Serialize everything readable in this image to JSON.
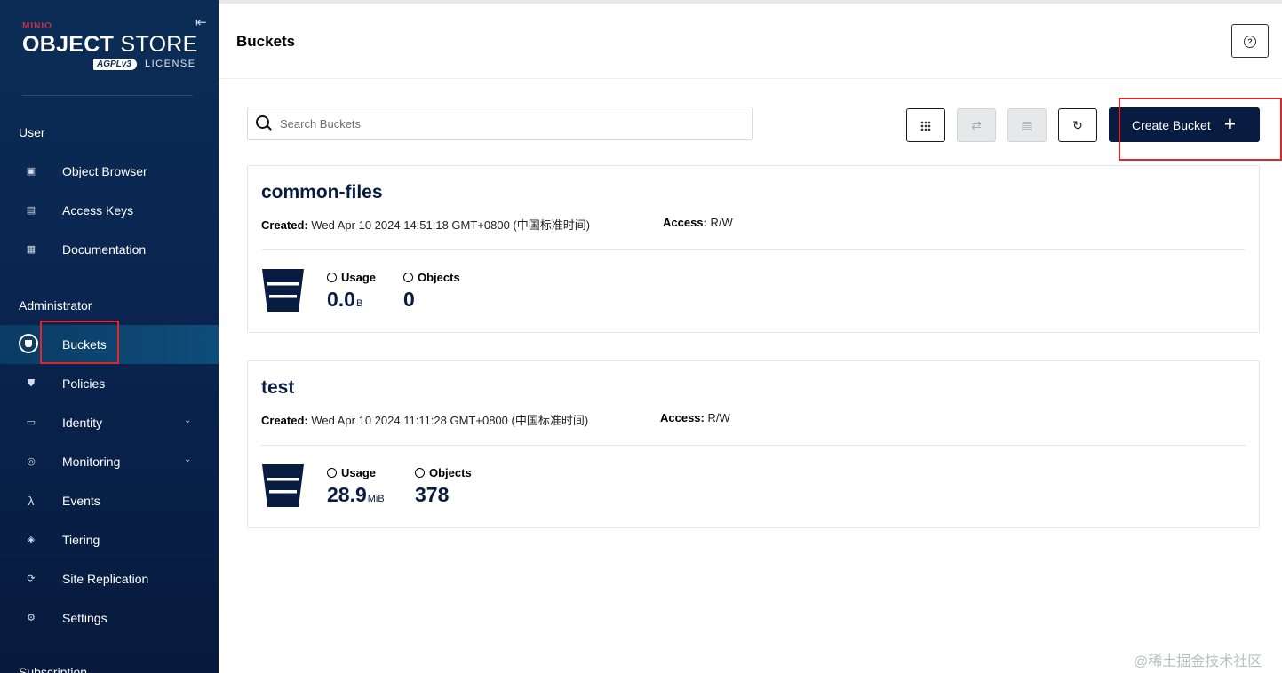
{
  "sidebar": {
    "logo": {
      "brand": "MINIO",
      "object": "OBJECT",
      "store": "STORE",
      "badge": "AGPLv3",
      "license": "LICENSE"
    },
    "sections": {
      "user": "User",
      "administrator": "Administrator",
      "subscription": "Subscription"
    },
    "user_items": [
      {
        "label": "Object Browser",
        "icon": "object-browser-icon"
      },
      {
        "label": "Access Keys",
        "icon": "access-keys-icon"
      },
      {
        "label": "Documentation",
        "icon": "documentation-icon"
      }
    ],
    "admin_items": [
      {
        "label": "Buckets",
        "icon": "bucket-icon",
        "active": true
      },
      {
        "label": "Policies",
        "icon": "shield-icon"
      },
      {
        "label": "Identity",
        "icon": "identity-icon"
      },
      {
        "label": "Monitoring",
        "icon": "monitoring-icon"
      },
      {
        "label": "Events",
        "icon": "lambda-icon"
      },
      {
        "label": "Tiering",
        "icon": "layers-icon"
      },
      {
        "label": "Site Replication",
        "icon": "replication-icon"
      },
      {
        "label": "Settings",
        "icon": "gear-icon"
      }
    ]
  },
  "header": {
    "title": "Buckets",
    "help_icon": "?"
  },
  "toolbar": {
    "search_placeholder": "Search Buckets",
    "create_label": "Create Bucket",
    "create_plus": "+"
  },
  "buckets": [
    {
      "name": "common-files",
      "created_label": "Created:",
      "created": "Wed Apr 10 2024 14:51:18 GMT+0800 (中国标准时间)",
      "access_label": "Access:",
      "access": "R/W",
      "usage_label": "Usage",
      "usage_value": "0.0",
      "usage_unit": "B",
      "objects_label": "Objects",
      "objects_value": "0"
    },
    {
      "name": "test",
      "created_label": "Created:",
      "created": "Wed Apr 10 2024 11:11:28 GMT+0800 (中国标准时间)",
      "access_label": "Access:",
      "access": "R/W",
      "usage_label": "Usage",
      "usage_value": "28.9",
      "usage_unit": "MiB",
      "objects_label": "Objects",
      "objects_value": "378"
    }
  ],
  "watermark": "@稀土掘金技术社区",
  "colors": {
    "sidebar_bg": "#0b2d55",
    "primary": "#081c42",
    "highlight": "#e0262d",
    "brand_red": "#c72e49"
  }
}
